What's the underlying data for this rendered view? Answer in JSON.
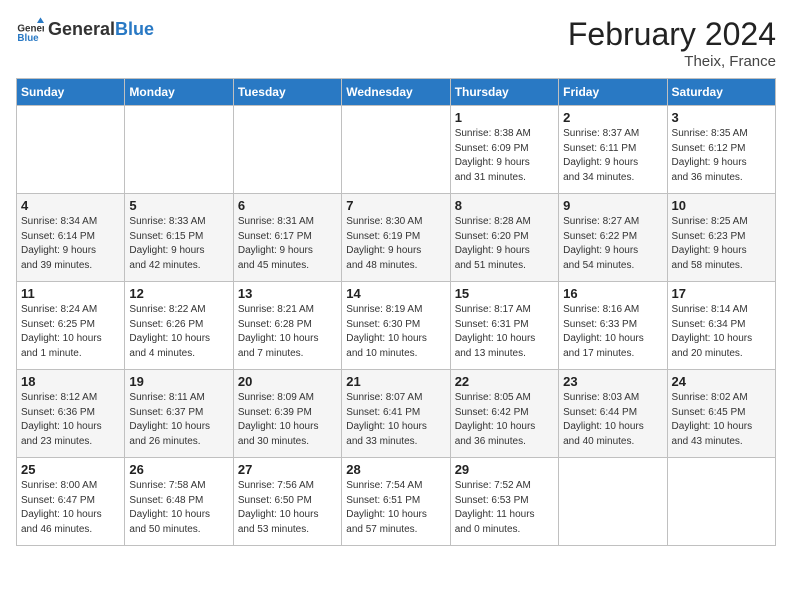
{
  "header": {
    "logo_text_general": "General",
    "logo_text_blue": "Blue",
    "month_year": "February 2024",
    "location": "Theix, France"
  },
  "weekdays": [
    "Sunday",
    "Monday",
    "Tuesday",
    "Wednesday",
    "Thursday",
    "Friday",
    "Saturday"
  ],
  "weeks": [
    [
      {
        "day": "",
        "info": ""
      },
      {
        "day": "",
        "info": ""
      },
      {
        "day": "",
        "info": ""
      },
      {
        "day": "",
        "info": ""
      },
      {
        "day": "1",
        "info": "Sunrise: 8:38 AM\nSunset: 6:09 PM\nDaylight: 9 hours\nand 31 minutes."
      },
      {
        "day": "2",
        "info": "Sunrise: 8:37 AM\nSunset: 6:11 PM\nDaylight: 9 hours\nand 34 minutes."
      },
      {
        "day": "3",
        "info": "Sunrise: 8:35 AM\nSunset: 6:12 PM\nDaylight: 9 hours\nand 36 minutes."
      }
    ],
    [
      {
        "day": "4",
        "info": "Sunrise: 8:34 AM\nSunset: 6:14 PM\nDaylight: 9 hours\nand 39 minutes."
      },
      {
        "day": "5",
        "info": "Sunrise: 8:33 AM\nSunset: 6:15 PM\nDaylight: 9 hours\nand 42 minutes."
      },
      {
        "day": "6",
        "info": "Sunrise: 8:31 AM\nSunset: 6:17 PM\nDaylight: 9 hours\nand 45 minutes."
      },
      {
        "day": "7",
        "info": "Sunrise: 8:30 AM\nSunset: 6:19 PM\nDaylight: 9 hours\nand 48 minutes."
      },
      {
        "day": "8",
        "info": "Sunrise: 8:28 AM\nSunset: 6:20 PM\nDaylight: 9 hours\nand 51 minutes."
      },
      {
        "day": "9",
        "info": "Sunrise: 8:27 AM\nSunset: 6:22 PM\nDaylight: 9 hours\nand 54 minutes."
      },
      {
        "day": "10",
        "info": "Sunrise: 8:25 AM\nSunset: 6:23 PM\nDaylight: 9 hours\nand 58 minutes."
      }
    ],
    [
      {
        "day": "11",
        "info": "Sunrise: 8:24 AM\nSunset: 6:25 PM\nDaylight: 10 hours\nand 1 minute."
      },
      {
        "day": "12",
        "info": "Sunrise: 8:22 AM\nSunset: 6:26 PM\nDaylight: 10 hours\nand 4 minutes."
      },
      {
        "day": "13",
        "info": "Sunrise: 8:21 AM\nSunset: 6:28 PM\nDaylight: 10 hours\nand 7 minutes."
      },
      {
        "day": "14",
        "info": "Sunrise: 8:19 AM\nSunset: 6:30 PM\nDaylight: 10 hours\nand 10 minutes."
      },
      {
        "day": "15",
        "info": "Sunrise: 8:17 AM\nSunset: 6:31 PM\nDaylight: 10 hours\nand 13 minutes."
      },
      {
        "day": "16",
        "info": "Sunrise: 8:16 AM\nSunset: 6:33 PM\nDaylight: 10 hours\nand 17 minutes."
      },
      {
        "day": "17",
        "info": "Sunrise: 8:14 AM\nSunset: 6:34 PM\nDaylight: 10 hours\nand 20 minutes."
      }
    ],
    [
      {
        "day": "18",
        "info": "Sunrise: 8:12 AM\nSunset: 6:36 PM\nDaylight: 10 hours\nand 23 minutes."
      },
      {
        "day": "19",
        "info": "Sunrise: 8:11 AM\nSunset: 6:37 PM\nDaylight: 10 hours\nand 26 minutes."
      },
      {
        "day": "20",
        "info": "Sunrise: 8:09 AM\nSunset: 6:39 PM\nDaylight: 10 hours\nand 30 minutes."
      },
      {
        "day": "21",
        "info": "Sunrise: 8:07 AM\nSunset: 6:41 PM\nDaylight: 10 hours\nand 33 minutes."
      },
      {
        "day": "22",
        "info": "Sunrise: 8:05 AM\nSunset: 6:42 PM\nDaylight: 10 hours\nand 36 minutes."
      },
      {
        "day": "23",
        "info": "Sunrise: 8:03 AM\nSunset: 6:44 PM\nDaylight: 10 hours\nand 40 minutes."
      },
      {
        "day": "24",
        "info": "Sunrise: 8:02 AM\nSunset: 6:45 PM\nDaylight: 10 hours\nand 43 minutes."
      }
    ],
    [
      {
        "day": "25",
        "info": "Sunrise: 8:00 AM\nSunset: 6:47 PM\nDaylight: 10 hours\nand 46 minutes."
      },
      {
        "day": "26",
        "info": "Sunrise: 7:58 AM\nSunset: 6:48 PM\nDaylight: 10 hours\nand 50 minutes."
      },
      {
        "day": "27",
        "info": "Sunrise: 7:56 AM\nSunset: 6:50 PM\nDaylight: 10 hours\nand 53 minutes."
      },
      {
        "day": "28",
        "info": "Sunrise: 7:54 AM\nSunset: 6:51 PM\nDaylight: 10 hours\nand 57 minutes."
      },
      {
        "day": "29",
        "info": "Sunrise: 7:52 AM\nSunset: 6:53 PM\nDaylight: 11 hours\nand 0 minutes."
      },
      {
        "day": "",
        "info": ""
      },
      {
        "day": "",
        "info": ""
      }
    ]
  ]
}
